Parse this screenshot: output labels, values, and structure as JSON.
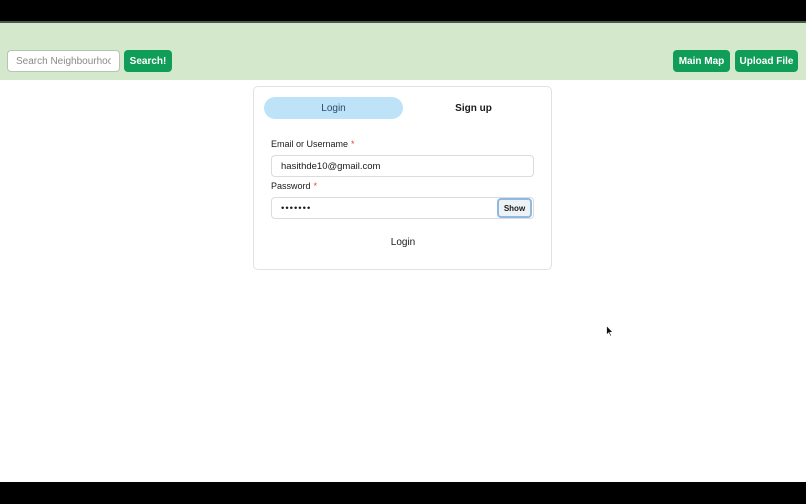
{
  "navbar": {
    "search_placeholder": "Search Neighbourhood",
    "search_button": "Search!",
    "main_map_button": "Main Map",
    "upload_file_button": "Upload File"
  },
  "auth": {
    "tabs": [
      {
        "label": "Login",
        "active": true
      },
      {
        "label": "Sign up",
        "active": false
      }
    ],
    "email_label": "Email or Username",
    "required_marker": "*",
    "email_value": "hasithde10@gmail.com",
    "password_label": "Password",
    "password_value": "•••••••",
    "show_button": "Show",
    "login_button": "Login"
  },
  "colors": {
    "navbar_bg": "#d4e8cb",
    "button_green": "#0f9d58",
    "active_tab": "#bee3f8",
    "required": "#e53e3e"
  },
  "icons": {
    "cursor": "mouse-pointer-icon"
  }
}
